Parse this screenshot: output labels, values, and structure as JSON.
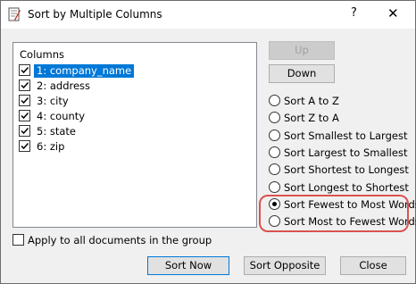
{
  "window": {
    "title": "Sort by Multiple Columns",
    "help_label": "?",
    "close_label": "✕"
  },
  "columns": {
    "header": "Columns",
    "items": [
      {
        "label": "1: company_name",
        "checked": true,
        "selected": true
      },
      {
        "label": "2: address",
        "checked": true,
        "selected": false
      },
      {
        "label": "3: city",
        "checked": true,
        "selected": false
      },
      {
        "label": "4: county",
        "checked": true,
        "selected": false
      },
      {
        "label": "5: state",
        "checked": true,
        "selected": false
      },
      {
        "label": "6: zip",
        "checked": true,
        "selected": false
      }
    ]
  },
  "move": {
    "up_label": "Up",
    "down_label": "Down"
  },
  "sort_options": [
    {
      "label": "Sort A to Z",
      "selected": false
    },
    {
      "label": "Sort Z to A",
      "selected": false
    },
    {
      "label": "Sort Smallest to Largest",
      "selected": false
    },
    {
      "label": "Sort Largest to Smallest",
      "selected": false
    },
    {
      "label": "Sort Shortest to Longest",
      "selected": false
    },
    {
      "label": "Sort Longest to Shortest",
      "selected": false
    },
    {
      "label": "Sort Fewest to Most Words",
      "selected": true
    },
    {
      "label": "Sort Most to Fewest Words",
      "selected": false
    }
  ],
  "apply_all": {
    "label": "Apply to all documents in the group",
    "checked": false
  },
  "buttons": {
    "sort_now": "Sort Now",
    "sort_opposite": "Sort Opposite",
    "close": "Close"
  },
  "colors": {
    "selection": "#0078d7",
    "highlight": "#d9534f"
  }
}
